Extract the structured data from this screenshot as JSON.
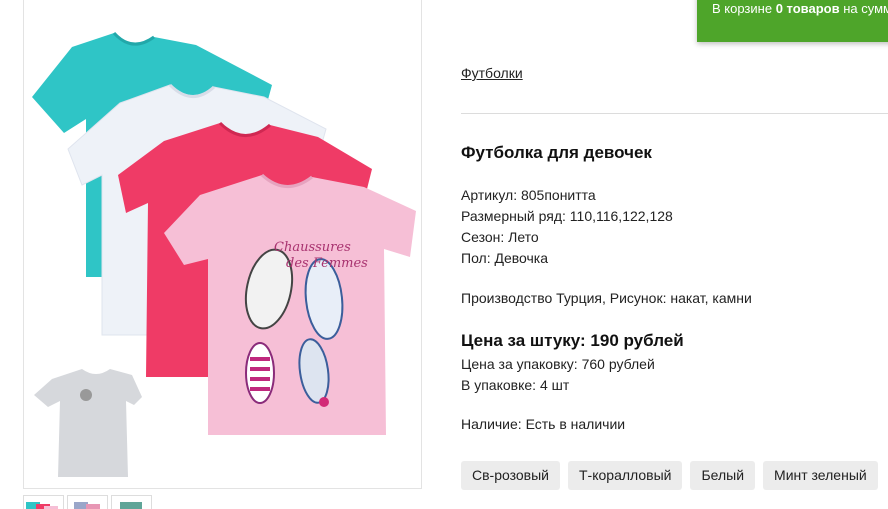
{
  "cart": {
    "prefix": "В корзине",
    "count": "0 товаров",
    "suffix": "на сумму"
  },
  "breadcrumb": "Футболки",
  "product": {
    "title": "Футболка для девочек",
    "specs": [
      "Артикул: 805понитта",
      "Размерный ряд: 110,116,122,128",
      "Сезон: Лето",
      "Пол: Девочка"
    ],
    "production": "Производство Турция, Рисунок: накат, камни",
    "price_per_item": "Цена за штуку: 190 рублей",
    "price_per_pack": "Цена за упаковку: 760 рублей",
    "pack_size": "В упаковке: 4 шт",
    "availability": "Наличие: Есть в наличии",
    "print_text": "Chaussures des Femmes"
  },
  "colors": [
    "Св-розовый",
    "Т-коралловый",
    "Белый",
    "Минт зеленый"
  ],
  "palette": {
    "mint": "#2fc5c6",
    "white": "#eef2f8",
    "coral": "#ef3b66",
    "pink": "#f6bfd6",
    "gray": "#d6d8dc",
    "cart_green": "#4ea52a"
  }
}
